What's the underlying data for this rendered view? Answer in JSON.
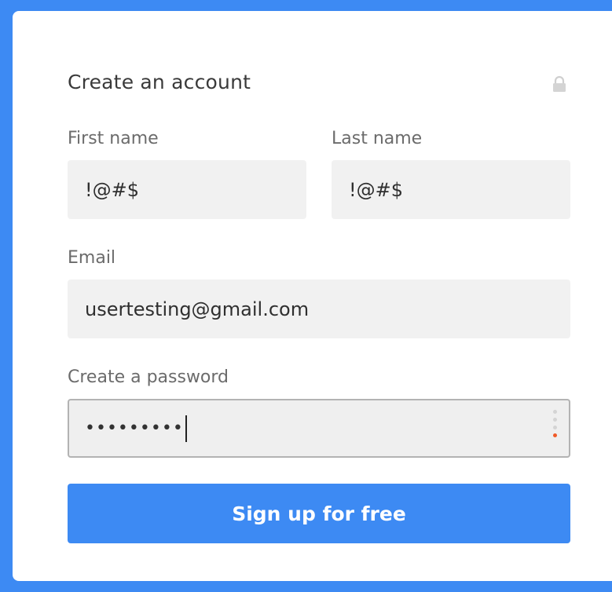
{
  "form": {
    "title": "Create an account",
    "first_name": {
      "label": "First name",
      "value": "!@#$"
    },
    "last_name": {
      "label": "Last name",
      "value": "!@#$"
    },
    "email": {
      "label": "Email",
      "value": "usertesting@gmail.com"
    },
    "password": {
      "label": "Create a password",
      "masked_value": "•••••••••",
      "strength_level": 1,
      "strength_max": 4
    },
    "submit_label": "Sign up for free"
  },
  "colors": {
    "accent": "#3d8af3",
    "strength_active": "#f05a28",
    "field_bg": "#f1f1f1"
  },
  "icons": {
    "lock": "lock-icon"
  }
}
